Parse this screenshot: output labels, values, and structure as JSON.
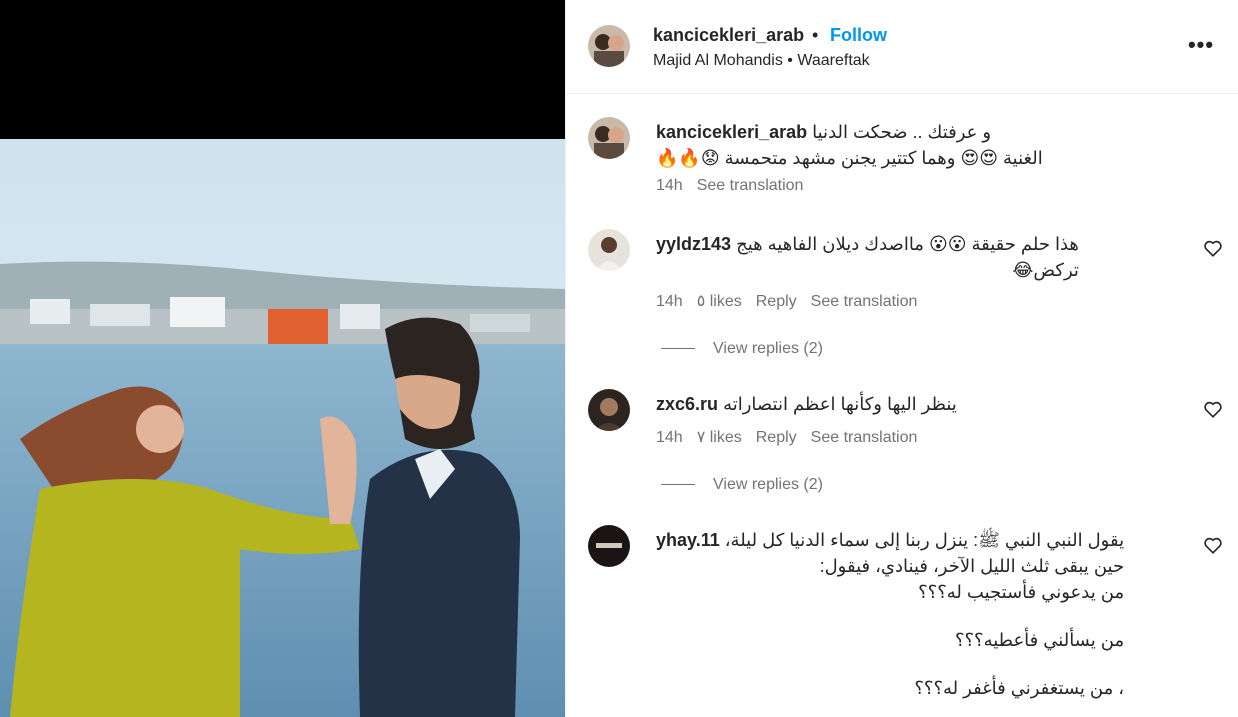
{
  "post": {
    "author": "kancicekleri_arab",
    "separator": "•",
    "follow_label": "Follow",
    "audio": "Majid Al Mohandis • Waareftak",
    "more_label": "•••"
  },
  "caption": {
    "user": "kancicekleri_arab",
    "line1": "و عرفتك .. ضحكت الدنيا",
    "line2": "الغنية 😍😍 وهما كتتير يجنن مشهد متحمسة 😟🔥🔥",
    "time": "14h",
    "see_translation": "See translation"
  },
  "comments": [
    {
      "user": "yyldz143",
      "line1": "هذا حلم حقيقة 😮😮 مااصدك ديلان الفاهيه هيج",
      "line2": "تركض😂",
      "time": "14h",
      "likes": "٥ likes",
      "reply": "Reply",
      "see_translation": "See translation",
      "view_replies": "View replies (2)"
    },
    {
      "user": "zxc6.ru",
      "line1": "ينظر اليها وكأنها اعظم انتصاراته",
      "time": "14h",
      "likes": "٧ likes",
      "reply": "Reply",
      "see_translation": "See translation",
      "view_replies": "View replies (2)"
    },
    {
      "user": "yhay.11",
      "line1": "يقول النبي النبي ﷺ: ينزل ربنا إلى سماء الدنيا كل ليلة،",
      "line2": "حين يبقى ثلث الليل الآخر، فينادي، فيقول:",
      "line3": "من يدعوني فأستجيب له؟؟؟",
      "line4": "من يسألني فأعطيه؟؟؟",
      "line5": "، من يستغفرني فأغفر له؟؟؟"
    }
  ],
  "colors": {
    "link": "#0095f6",
    "secondary_text": "#737373",
    "divider": "#efefef"
  }
}
